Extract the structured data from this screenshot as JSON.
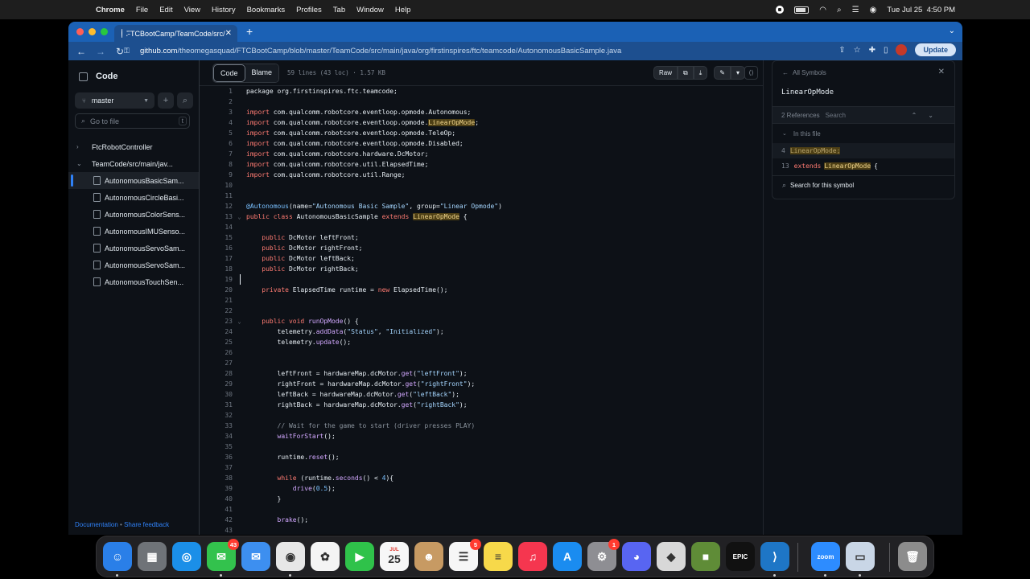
{
  "menubar": {
    "app": "Chrome",
    "items": [
      "File",
      "Edit",
      "View",
      "History",
      "Bookmarks",
      "Profiles",
      "Tab",
      "Window",
      "Help"
    ],
    "clock": "Tue Jul 25  4:50 PM"
  },
  "browser": {
    "tab_title": "FTCBootCamp/TeamCode/src/",
    "url_host": "github.com",
    "url_path": "/theomegasquad/FTCBootCamp/blob/master/TeamCode/src/main/java/org/firstinspires/ftc/teamcode/AutonomousBasicSample.java",
    "update_label": "Update"
  },
  "sidebar": {
    "title": "Code",
    "branch": "master",
    "goto_placeholder": "Go to file",
    "goto_shortcut": "t",
    "tree": [
      {
        "label": "FtcRobotController",
        "type": "folder",
        "expanded": false
      },
      {
        "label": "TeamCode/src/main/jav...",
        "type": "folder",
        "expanded": true
      },
      {
        "label": "AutonomousBasicSam...",
        "type": "file",
        "selected": true
      },
      {
        "label": "AutonomousCircleBasi...",
        "type": "file"
      },
      {
        "label": "AutonomousColorSens...",
        "type": "file"
      },
      {
        "label": "AutonomousIMUSenso...",
        "type": "file"
      },
      {
        "label": "AutonomousServoSam...",
        "type": "file"
      },
      {
        "label": "AutonomousServoSam...",
        "type": "file"
      },
      {
        "label": "AutonomousTouchSen...",
        "type": "file"
      }
    ],
    "footer_link1": "Documentation",
    "footer_sep": "•",
    "footer_link2": "Share feedback"
  },
  "file": {
    "tab_code": "Code",
    "tab_blame": "Blame",
    "info": "59 lines (43 loc) · 1.57 KB",
    "raw_label": "Raw"
  },
  "code_lines": [
    [
      [
        "kw-none",
        "package org.firstinspires.ftc.teamcode;"
      ]
    ],
    [],
    [
      [
        "kw",
        "import"
      ],
      [
        "t",
        " com.qualcomm.robotcore.eventloop.opmode.Autonomous;"
      ]
    ],
    [
      [
        "kw",
        "import"
      ],
      [
        "t",
        " com.qualcomm.robotcore.eventloop.opmode."
      ],
      [
        "hl",
        "LinearOpMode"
      ],
      [
        "t",
        ";"
      ]
    ],
    [
      [
        "kw",
        "import"
      ],
      [
        "t",
        " com.qualcomm.robotcore.eventloop.opmode.TeleOp;"
      ]
    ],
    [
      [
        "kw",
        "import"
      ],
      [
        "t",
        " com.qualcomm.robotcore.eventloop.opmode.Disabled;"
      ]
    ],
    [
      [
        "kw",
        "import"
      ],
      [
        "t",
        " com.qualcomm.robotcore.hardware.DcMotor;"
      ]
    ],
    [
      [
        "kw",
        "import"
      ],
      [
        "t",
        " com.qualcomm.robotcore.util.ElapsedTime;"
      ]
    ],
    [
      [
        "kw",
        "import"
      ],
      [
        "t",
        " com.qualcomm.robotcore.util.Range;"
      ]
    ],
    [],
    [],
    [
      [
        "an",
        "@Autonomous"
      ],
      [
        "t",
        "(name="
      ],
      [
        "st",
        "\"Autonomous Basic Sample\""
      ],
      [
        "t",
        ", group="
      ],
      [
        "st",
        "\"Linear Opmode\""
      ],
      [
        "t",
        ")"
      ]
    ],
    [
      [
        "kw",
        "public class"
      ],
      [
        "t",
        " AutonomousBasicSample "
      ],
      [
        "kw",
        "extends"
      ],
      [
        "t",
        " "
      ],
      [
        "hl",
        "LinearOpMode"
      ],
      [
        "t",
        " {"
      ]
    ],
    [],
    [
      [
        "t",
        "    "
      ],
      [
        "kw",
        "public"
      ],
      [
        "t",
        " DcMotor leftFront;"
      ]
    ],
    [
      [
        "t",
        "    "
      ],
      [
        "kw",
        "public"
      ],
      [
        "t",
        " DcMotor rightFront;"
      ]
    ],
    [
      [
        "t",
        "    "
      ],
      [
        "kw",
        "public"
      ],
      [
        "t",
        " DcMotor leftBack;"
      ]
    ],
    [
      [
        "t",
        "    "
      ],
      [
        "kw",
        "public"
      ],
      [
        "t",
        " DcMotor rightBack;"
      ]
    ],
    [],
    [
      [
        "t",
        "    "
      ],
      [
        "kw",
        "private"
      ],
      [
        "t",
        " ElapsedTime runtime = "
      ],
      [
        "kw",
        "new"
      ],
      [
        "t",
        " ElapsedTime();"
      ]
    ],
    [],
    [],
    [
      [
        "t",
        "    "
      ],
      [
        "kw",
        "public void"
      ],
      [
        "t",
        " "
      ],
      [
        "fn",
        "runOpMode"
      ],
      [
        "t",
        "() {"
      ]
    ],
    [
      [
        "t",
        "        telemetry."
      ],
      [
        "fn",
        "addData"
      ],
      [
        "t",
        "("
      ],
      [
        "st",
        "\"Status\""
      ],
      [
        "t",
        ", "
      ],
      [
        "st",
        "\"Initialized\""
      ],
      [
        "t",
        ");"
      ]
    ],
    [
      [
        "t",
        "        telemetry."
      ],
      [
        "fn",
        "update"
      ],
      [
        "t",
        "();"
      ]
    ],
    [],
    [],
    [
      [
        "t",
        "        leftFront = hardwareMap.dcMotor."
      ],
      [
        "fn",
        "get"
      ],
      [
        "t",
        "("
      ],
      [
        "st",
        "\"leftFront\""
      ],
      [
        "t",
        ");"
      ]
    ],
    [
      [
        "t",
        "        rightFront = hardwareMap.dcMotor."
      ],
      [
        "fn",
        "get"
      ],
      [
        "t",
        "("
      ],
      [
        "st",
        "\"rightFront\""
      ],
      [
        "t",
        ");"
      ]
    ],
    [
      [
        "t",
        "        leftBack = hardwareMap.dcMotor."
      ],
      [
        "fn",
        "get"
      ],
      [
        "t",
        "("
      ],
      [
        "st",
        "\"leftBack\""
      ],
      [
        "t",
        ");"
      ]
    ],
    [
      [
        "t",
        "        rightBack = hardwareMap.dcMotor."
      ],
      [
        "fn",
        "get"
      ],
      [
        "t",
        "("
      ],
      [
        "st",
        "\"rightBack\""
      ],
      [
        "t",
        ");"
      ]
    ],
    [],
    [
      [
        "t",
        "        "
      ],
      [
        "cm",
        "// Wait for the game to start (driver presses PLAY)"
      ]
    ],
    [
      [
        "t",
        "        "
      ],
      [
        "fn",
        "waitForStart"
      ],
      [
        "t",
        "();"
      ]
    ],
    [],
    [
      [
        "t",
        "        runtime."
      ],
      [
        "fn",
        "reset"
      ],
      [
        "t",
        "();"
      ]
    ],
    [],
    [
      [
        "t",
        "        "
      ],
      [
        "kw",
        "while"
      ],
      [
        "t",
        " (runtime."
      ],
      [
        "fn",
        "seconds"
      ],
      [
        "t",
        "() < "
      ],
      [
        "nu",
        "4"
      ],
      [
        "t",
        "){"
      ]
    ],
    [
      [
        "t",
        "            "
      ],
      [
        "fn",
        "drive"
      ],
      [
        "t",
        "("
      ],
      [
        "nu",
        "0.5"
      ],
      [
        "t",
        ");"
      ]
    ],
    [
      [
        "t",
        "        }"
      ]
    ],
    [],
    [
      [
        "t",
        "        "
      ],
      [
        "fn",
        "brake"
      ],
      [
        "t",
        "();"
      ]
    ],
    []
  ],
  "references": {
    "back_label": "All Symbols",
    "symbol": "LinearOpMode",
    "count_label": "2 References",
    "search_placeholder": "Search",
    "in_file_label": "In this file",
    "ref1_line": "4",
    "ref1_code": "LinearOpMode;",
    "ref2_line": "13",
    "ref2_kw": "extends",
    "ref2_sym": "LinearOpMode",
    "ref2_tail": "{",
    "search_symbol_label": "Search for this symbol"
  },
  "dock": {
    "items": [
      {
        "name": "finder",
        "color": "#2a7fe8",
        "glyph": "☺"
      },
      {
        "name": "launchpad",
        "color": "#6f7378",
        "glyph": "▦"
      },
      {
        "name": "safari",
        "color": "#1b8fe8",
        "glyph": "◎"
      },
      {
        "name": "messages",
        "color": "#33c24d",
        "glyph": "✉",
        "badge": "43"
      },
      {
        "name": "mail",
        "color": "#3d8ff0",
        "glyph": "✉"
      },
      {
        "name": "chrome",
        "color": "#e7e7e7",
        "glyph": "◉"
      },
      {
        "name": "photos",
        "color": "#f4f4f4",
        "glyph": "✿"
      },
      {
        "name": "facetime",
        "color": "#2fc24a",
        "glyph": "▶"
      },
      {
        "name": "calendar",
        "color": "#f7f7f7",
        "glyph": "25",
        "sub": "JUL"
      },
      {
        "name": "contacts",
        "color": "#c79a63",
        "glyph": "☻"
      },
      {
        "name": "reminders",
        "color": "#f6f6f6",
        "glyph": "☰",
        "badge": "5"
      },
      {
        "name": "notes",
        "color": "#f7d94a",
        "glyph": "≡"
      },
      {
        "name": "music",
        "color": "#f5364f",
        "glyph": "♫"
      },
      {
        "name": "app-store",
        "color": "#1a8cf0",
        "glyph": "A"
      },
      {
        "name": "system-settings",
        "color": "#8e8e93",
        "glyph": "⚙",
        "badge": "1"
      },
      {
        "name": "discord",
        "color": "#5865f2",
        "glyph": "◕"
      },
      {
        "name": "roblox",
        "color": "#d8d8d8",
        "glyph": "◆"
      },
      {
        "name": "minecraft",
        "color": "#5f8c37",
        "glyph": "■"
      },
      {
        "name": "epic-games",
        "color": "#111111",
        "glyph": "EPIC"
      },
      {
        "name": "vscode",
        "color": "#1e76c6",
        "glyph": "⟩"
      },
      {
        "name": "zoom",
        "color": "#2d8cff",
        "glyph": "zoom"
      },
      {
        "name": "preview",
        "color": "#c9d6e6",
        "glyph": "▭"
      },
      {
        "name": "trash",
        "color": "#8c8c8c",
        "glyph": "🗑"
      }
    ]
  }
}
